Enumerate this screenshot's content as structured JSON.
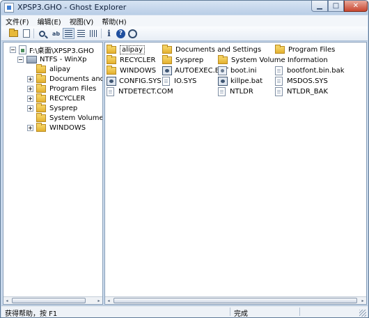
{
  "window": {
    "title": "XPSP3.GHO - Ghost Explorer",
    "min_glyph": "▁",
    "max_glyph": "□",
    "close_glyph": "✕"
  },
  "menu": {
    "items": [
      "文件(F)",
      "编辑(E)",
      "视图(V)",
      "帮助(H)"
    ]
  },
  "toolbar": {
    "icons": [
      "open-icon",
      "extract-icon",
      "find-icon",
      "small-icons-view-icon",
      "list-view-icon",
      "details-view-icon",
      "properties-icon",
      "help-icon",
      "web-icon"
    ]
  },
  "tree": {
    "root": "F:\\桌面\\XPSP3.GHO",
    "volume": "NTFS - WinXp",
    "folders": [
      "alipay",
      "Documents and Sett",
      "Program Files",
      "RECYCLER",
      "Sysprep",
      "System Volume Infc",
      "WINDOWS"
    ],
    "expandable": [
      false,
      true,
      true,
      true,
      true,
      false,
      true
    ]
  },
  "files": {
    "items": [
      {
        "name": "alipay",
        "type": "folder",
        "selected": true
      },
      {
        "name": "Documents and Settings",
        "type": "folder"
      },
      {
        "name": "Program Files",
        "type": "folder"
      },
      {
        "name": "RECYCLER",
        "type": "folder"
      },
      {
        "name": "Sysprep",
        "type": "folder"
      },
      {
        "name": "System Volume Information",
        "type": "folder"
      },
      {
        "name": "WINDOWS",
        "type": "folder"
      },
      {
        "name": "AUTOEXEC.BAT",
        "type": "bat"
      },
      {
        "name": "boot.ini",
        "type": "sys"
      },
      {
        "name": "bootfont.bin.bak",
        "type": "doc"
      },
      {
        "name": "CONFIG.SYS",
        "type": "bat"
      },
      {
        "name": "IO.SYS",
        "type": "doc"
      },
      {
        "name": "killpe.bat",
        "type": "bat"
      },
      {
        "name": "MSDOS.SYS",
        "type": "doc"
      },
      {
        "name": "NTDETECT.COM",
        "type": "doc"
      },
      {
        "name": "NTLDR",
        "type": "doc"
      },
      {
        "name": "NTLDR_BAK",
        "type": "doc"
      }
    ]
  },
  "scroll": {
    "left_glyph": "◂",
    "right_glyph": "▸",
    "thumb_grip": "|||"
  },
  "status": {
    "left": "获得帮助，按 F1",
    "right": "完成"
  }
}
